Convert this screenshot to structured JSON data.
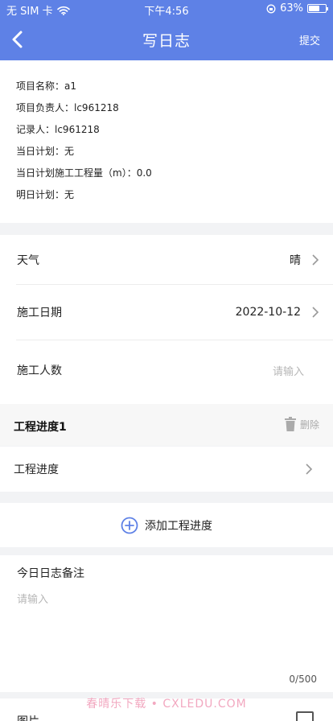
{
  "status_bar": {
    "carrier": "无 SIM 卡",
    "time": "下午4:56",
    "battery": "63%",
    "battery_level": 0.63
  },
  "nav": {
    "title": "写日志",
    "submit": "提交"
  },
  "info": {
    "project_name": "项目名称：a1",
    "project_owner": "项目负责人：lc961218",
    "recorder": "记录人：lc961218",
    "today_plan": "当日计划：无",
    "today_plan_quantity": "当日计划施工工程量（m）：0.0",
    "tomorrow_plan": "明日计划：无"
  },
  "fields": {
    "weather_label": "天气",
    "weather_value": "晴",
    "date_label": "施工日期",
    "date_value": "2022-10-12",
    "workers_label": "施工人数",
    "workers_placeholder": "请输入"
  },
  "progress": {
    "title": "工程进度1",
    "delete": "删除",
    "item_label": "工程进度",
    "add_label": "添加工程进度"
  },
  "notes": {
    "title": "今日日志备注",
    "placeholder": "请输入",
    "count": "0/500"
  },
  "picture": {
    "label": "图片"
  },
  "watermark": "春晴乐下载 • CXLEDU.COM",
  "colors": {
    "accent": "#5e81e6",
    "watermark": "#f2a8c0"
  }
}
